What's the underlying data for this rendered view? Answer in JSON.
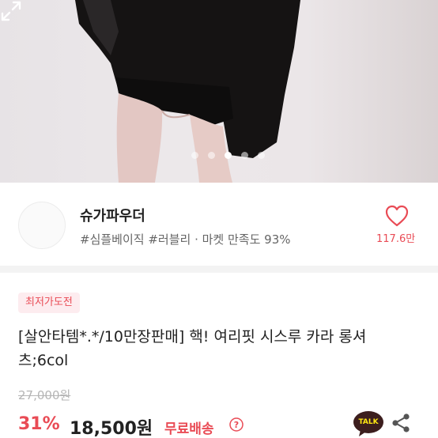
{
  "gallery": {
    "slide_count": 5,
    "active_index": 2,
    "expand_icon": "expand-icon"
  },
  "seller": {
    "name": "슈가파우더",
    "tags": "#심플베이직 #러블리 · 마켓 만족도 93%",
    "likes": "117.6만",
    "like_icon": "heart-icon"
  },
  "product": {
    "badge": "최저가도전",
    "title": "[살안타템*.*/10만장판매] 핵! 여리핏 시스루 카라 롱셔츠;6col",
    "original_price": "27,000원",
    "discount": "31%",
    "price": "18,500원",
    "shipping": "무료배송",
    "shipping_icon": "help-icon"
  },
  "actions": {
    "talk_label": "TALK",
    "share_icon": "share-icon"
  },
  "colors": {
    "accent": "#e94b55",
    "badge_bg": "#fdecef",
    "talk_bg": "#3c1e1e"
  }
}
